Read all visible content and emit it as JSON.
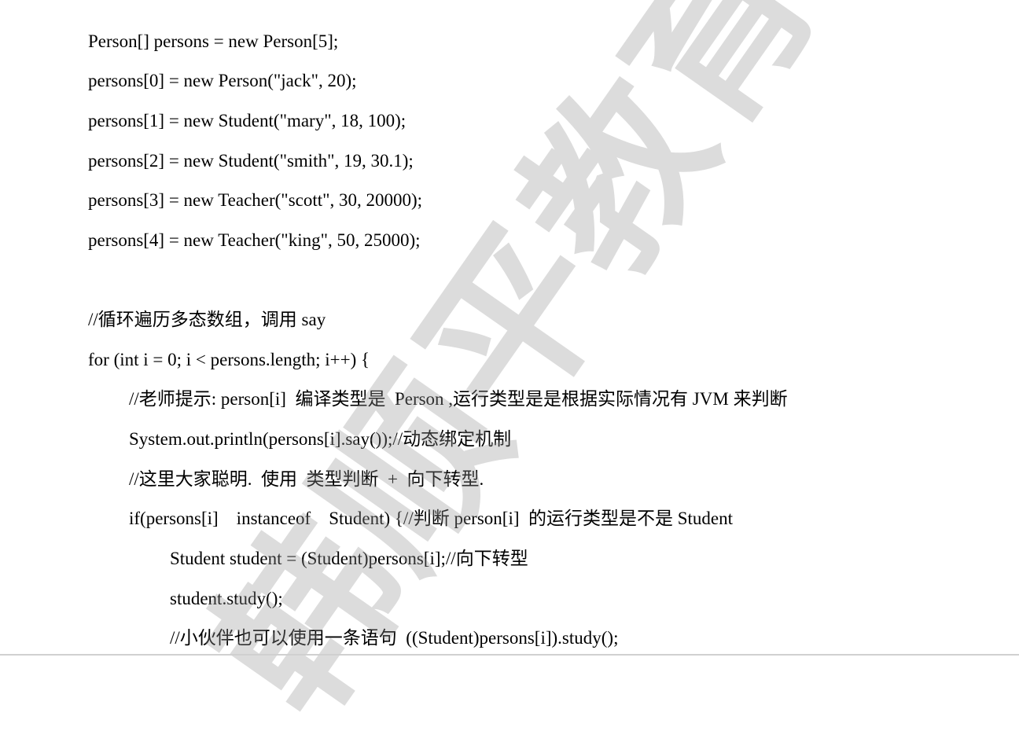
{
  "watermark": {
    "text": "韩顺平教育"
  },
  "code_lines": [
    "Person[] persons = new Person[5];",
    "persons[0] = new Person(\"jack\", 20);",
    "persons[1] = new Student(\"mary\", 18, 100);",
    "persons[2] = new Student(\"smith\", 19, 30.1);",
    "persons[3] = new Teacher(\"scott\", 30, 20000);",
    "persons[4] = new Teacher(\"king\", 50, 25000);",
    "//循环遍历多态数组，调用 say",
    "for (int i = 0; i < persons.length; i++) {",
    "//老师提示: person[i]  编译类型是  Person ,运行类型是是根据实际情况有 JVM 来判断",
    "System.out.println(persons[i].say());//动态绑定机制",
    "//这里大家聪明.  使用  类型判断  +  向下转型.",
    "if(persons[i]    instanceof    Student) {//判断 person[i]  的运行类型是不是 Student",
    "Student student = (Student)persons[i];//向下转型",
    "student.study();",
    "//小伙伴也可以使用一条语句  ((Student)persons[i]).study();"
  ]
}
